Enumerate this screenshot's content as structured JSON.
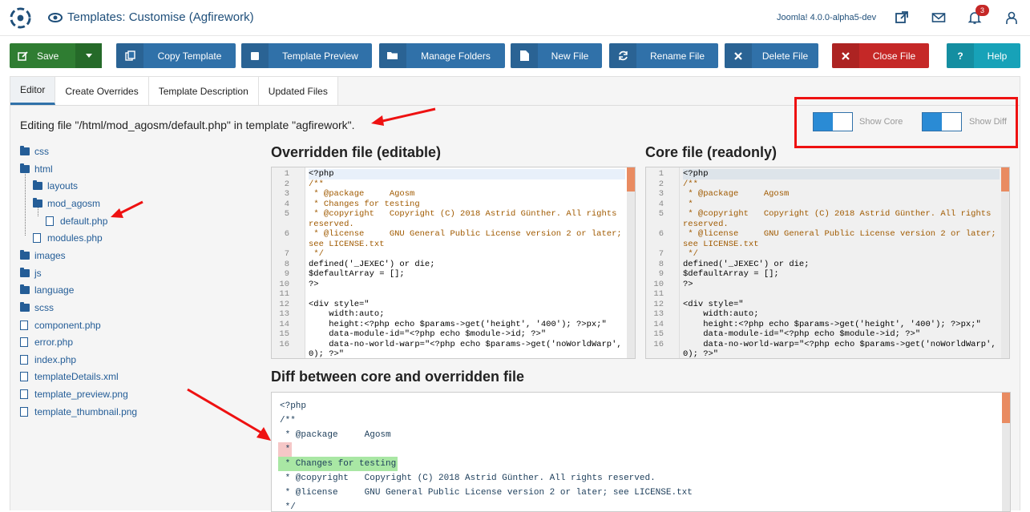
{
  "header": {
    "title": "Templates: Customise (Agfirework)",
    "version": "Joomla! 4.0.0-alpha5-dev",
    "notifications": "3"
  },
  "toolbar": {
    "save": "Save",
    "copy_template": "Copy Template",
    "template_preview": "Template Preview",
    "manage_folders": "Manage Folders",
    "new_file": "New File",
    "rename_file": "Rename File",
    "delete_file": "Delete File",
    "close_file": "Close File",
    "help": "Help"
  },
  "tabs": [
    "Editor",
    "Create Overrides",
    "Template Description",
    "Updated Files"
  ],
  "editing_text": "Editing file \"/html/mod_agosm/default.php\" in template \"agfirework\".",
  "toggles": {
    "show_core": "Show Core",
    "show_diff": "Show Diff"
  },
  "tree": [
    "css",
    "html",
    "layouts",
    "mod_agosm",
    "default.php",
    "modules.php",
    "images",
    "js",
    "language",
    "scss",
    "component.php",
    "error.php",
    "index.php",
    "templateDetails.xml",
    "template_preview.png",
    "template_thumbnail.png"
  ],
  "overridden_title": "Overridden file (editable)",
  "core_title": "Core file (readonly)",
  "diff_title": "Diff between core and overridden file",
  "overridden_code": [
    {
      "n": "1",
      "t": "<?php"
    },
    {
      "n": "2",
      "t": "/**"
    },
    {
      "n": "3",
      "t": " * @package     Agosm"
    },
    {
      "n": "4",
      "t": " * Changes for testing"
    },
    {
      "n": "5",
      "t": " * @copyright   Copyright (C) 2018 Astrid Günther. All rights reserved."
    },
    {
      "n": "6",
      "t": " * @license     GNU General Public License version 2 or later; see LICENSE.txt"
    },
    {
      "n": "7",
      "t": " */"
    },
    {
      "n": "8",
      "t": "defined('_JEXEC') or die;"
    },
    {
      "n": "9",
      "t": "$defaultArray = [];"
    },
    {
      "n": "10",
      "t": "?>"
    },
    {
      "n": "11",
      "t": ""
    },
    {
      "n": "12",
      "t": "<div style=\""
    },
    {
      "n": "13",
      "t": "    width:auto;"
    },
    {
      "n": "14",
      "t": "    height:<?php echo $params->get('height', '400'); ?>px;\""
    },
    {
      "n": "15",
      "t": "    data-module-id=\"<?php echo $module->id; ?>\""
    },
    {
      "n": "16",
      "t": "    data-no-world-warp=\"<?php echo $params->get('noWorldWarp', 0); ?>\""
    }
  ],
  "core_code": [
    {
      "n": "1",
      "t": "<?php"
    },
    {
      "n": "2",
      "t": "/**"
    },
    {
      "n": "3",
      "t": " * @package     Agosm"
    },
    {
      "n": "4",
      "t": " *"
    },
    {
      "n": "5",
      "t": " * @copyright   Copyright (C) 2018 Astrid Günther. All rights reserved."
    },
    {
      "n": "6",
      "t": " * @license     GNU General Public License version 2 or later; see LICENSE.txt"
    },
    {
      "n": "7",
      "t": " */"
    },
    {
      "n": "8",
      "t": "defined('_JEXEC') or die;"
    },
    {
      "n": "9",
      "t": "$defaultArray = [];"
    },
    {
      "n": "10",
      "t": "?>"
    },
    {
      "n": "11",
      "t": ""
    },
    {
      "n": "12",
      "t": "<div style=\""
    },
    {
      "n": "13",
      "t": "    width:auto;"
    },
    {
      "n": "14",
      "t": "    height:<?php echo $params->get('height', '400'); ?>px;\""
    },
    {
      "n": "15",
      "t": "    data-module-id=\"<?php echo $module->id; ?>\""
    },
    {
      "n": "16",
      "t": "    data-no-world-warp=\"<?php echo $params->get('noWorldWarp', 0); ?>\""
    }
  ],
  "diff_lines": [
    {
      "type": "same",
      "t": "<?php"
    },
    {
      "type": "same",
      "t": "/**"
    },
    {
      "type": "same",
      "t": " * @package     Agosm"
    },
    {
      "type": "del",
      "t": " *"
    },
    {
      "type": "add",
      "t": " * Changes for testing"
    },
    {
      "type": "same",
      "t": " * @copyright   Copyright (C) 2018 Astrid Günther. All rights reserved."
    },
    {
      "type": "same",
      "t": " * @license     GNU General Public License version 2 or later; see LICENSE.txt"
    },
    {
      "type": "same",
      "t": " */"
    }
  ]
}
